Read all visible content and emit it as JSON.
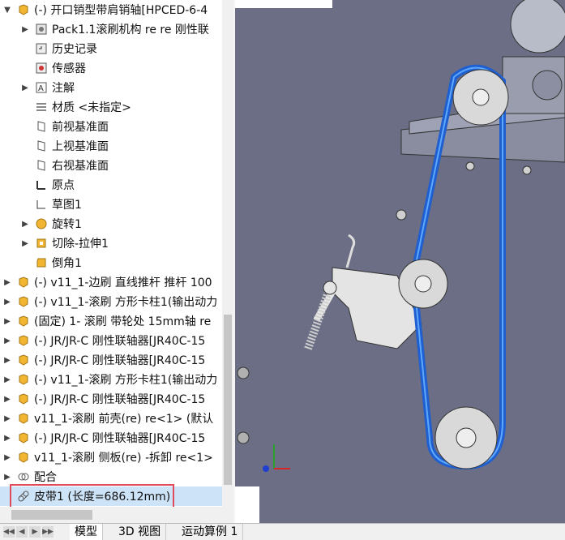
{
  "feature_tree": {
    "items": [
      {
        "label": "(-) 开口销型带肩销轴[HPCED-6-4",
        "expander": "▼",
        "icon": "part-icon"
      },
      {
        "label": "Pack1.1滚刷机构 re  re 刚性联",
        "expander": "▶",
        "icon": "pack-icon"
      },
      {
        "label": "历史记录",
        "expander": "",
        "icon": "history-icon"
      },
      {
        "label": "传感器",
        "expander": "",
        "icon": "sensor-icon"
      },
      {
        "label": "注解",
        "expander": "▶",
        "icon": "annotation-icon"
      },
      {
        "label": "材质 <未指定>",
        "expander": "",
        "icon": "material-icon"
      },
      {
        "label": "前视基准面",
        "expander": "",
        "icon": "plane-icon"
      },
      {
        "label": "上视基准面",
        "expander": "",
        "icon": "plane-icon"
      },
      {
        "label": "右视基准面",
        "expander": "",
        "icon": "plane-icon"
      },
      {
        "label": "原点",
        "expander": "",
        "icon": "origin-icon"
      },
      {
        "label": "草图1",
        "expander": "",
        "icon": "sketch-icon"
      },
      {
        "label": "旋转1",
        "expander": "▶",
        "icon": "revolve-icon"
      },
      {
        "label": "切除-拉伸1",
        "expander": "▶",
        "icon": "cut-extrude-icon"
      },
      {
        "label": "倒角1",
        "expander": "",
        "icon": "chamfer-icon"
      },
      {
        "label": "(-) v11_1-边刷 直线推杆 推杆 100",
        "expander": "▶",
        "icon": "part-icon"
      },
      {
        "label": "(-) v11_1-滚刷 方形卡柱1(输出动力",
        "expander": "▶",
        "icon": "part-icon"
      },
      {
        "label": "(固定) 1- 滚刷 带轮处 15mm轴 re",
        "expander": "▶",
        "icon": "part-icon"
      },
      {
        "label": "(-) JR/JR-C 刚性联轴器[JR40C-15",
        "expander": "▶",
        "icon": "part-icon"
      },
      {
        "label": "(-) JR/JR-C 刚性联轴器[JR40C-15",
        "expander": "▶",
        "icon": "part-icon"
      },
      {
        "label": "(-) v11_1-滚刷 方形卡柱1(输出动力",
        "expander": "▶",
        "icon": "part-icon"
      },
      {
        "label": "(-) JR/JR-C 刚性联轴器[JR40C-15",
        "expander": "▶",
        "icon": "part-icon"
      },
      {
        "label": "v11_1-滚刷 前壳(re) re<1> (默认",
        "expander": "▶",
        "icon": "part-icon"
      },
      {
        "label": "(-) JR/JR-C 刚性联轴器[JR40C-15",
        "expander": "▶",
        "icon": "part-icon"
      },
      {
        "label": "v11_1-滚刷 侧板(re) -拆卸 re<1>",
        "expander": "▶",
        "icon": "part-icon"
      },
      {
        "label": "配合",
        "expander": "▶",
        "icon": "mates-icon"
      },
      {
        "label": "皮带1 (长度=686.12mm)",
        "expander": "",
        "icon": "belt-icon"
      }
    ]
  },
  "tabs": [
    "模型",
    "3D 视图",
    "运动算例 1"
  ],
  "nav_buttons": [
    "◀◀",
    "◀",
    "▶",
    "▶▶"
  ],
  "colors": {
    "accent": "#e04a5a",
    "part_yellow": "#f2b531",
    "plate_gray": "#6b6e84",
    "belt_blue": "#1f5fd0"
  }
}
